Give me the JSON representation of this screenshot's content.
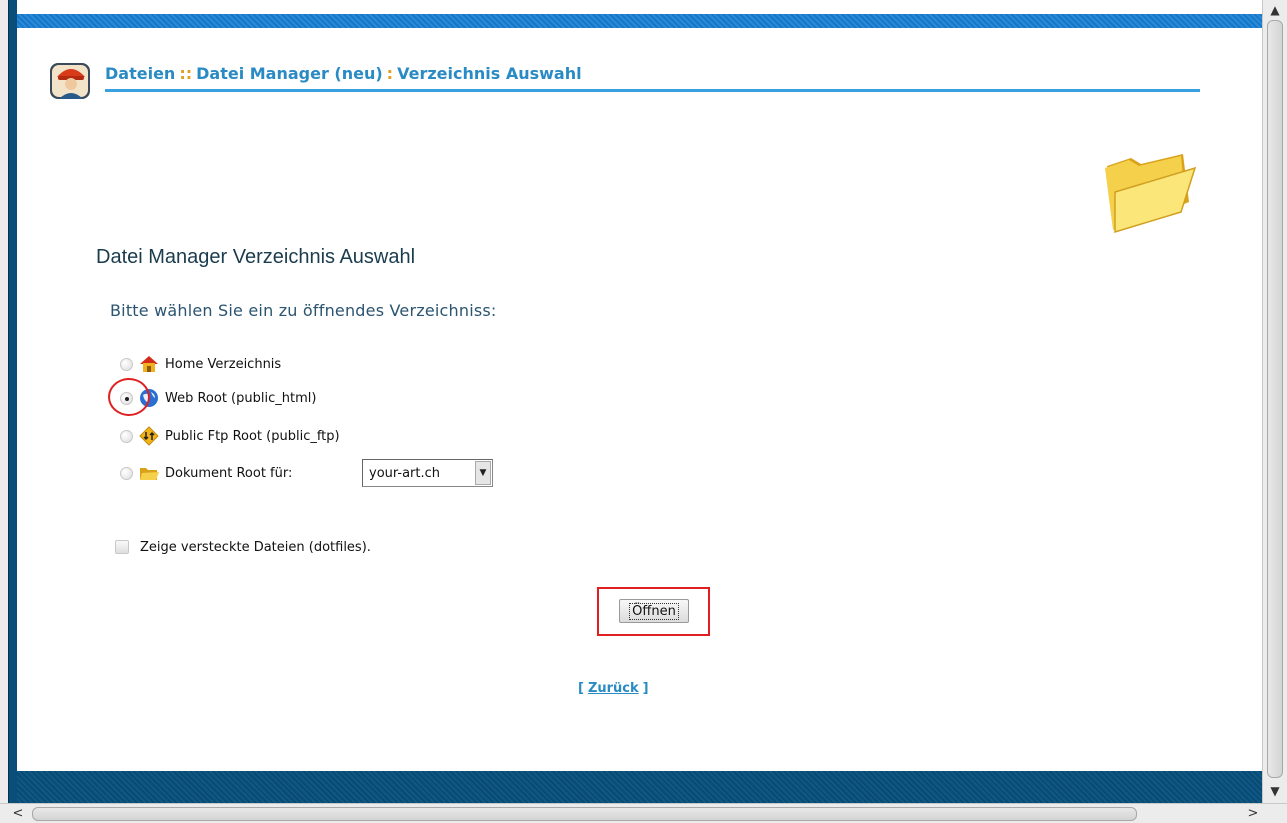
{
  "header": {
    "breadcrumb": {
      "items": [
        "Dateien",
        "Datei Manager (neu)",
        "Verzeichnis Auswahl"
      ],
      "separators": [
        "::",
        ":"
      ]
    },
    "avatar_icon": "user-avatar-icon",
    "accent_color": "#2a8bc4"
  },
  "main": {
    "title": "Datei Manager Verzeichnis Auswahl",
    "prompt": "Bitte wählen Sie ein zu öffnendes Verzeichniss:",
    "options": [
      {
        "label": "Home Verzeichnis",
        "icon": "home-icon",
        "selected": false
      },
      {
        "label": "Web Root (public_html)",
        "icon": "globe-icon",
        "selected": true
      },
      {
        "label": "Public Ftp Root (public_ftp)",
        "icon": "ftp-icon",
        "selected": false
      },
      {
        "label": "Dokument Root für:",
        "icon": "folder-icon",
        "selected": false
      }
    ],
    "document_root_select": {
      "value": "your-art.ch"
    },
    "show_hidden_files": {
      "label": "Zeige versteckte Dateien (dotfiles).",
      "checked": false
    },
    "open_button_label": "Öffnen",
    "back_link": {
      "open": "[",
      "label": "Zurück",
      "close": "]"
    }
  },
  "colors": {
    "top_bar": "#1677c9",
    "bottom_bar": "#0a4a72",
    "annotation_red": "#e02020"
  }
}
